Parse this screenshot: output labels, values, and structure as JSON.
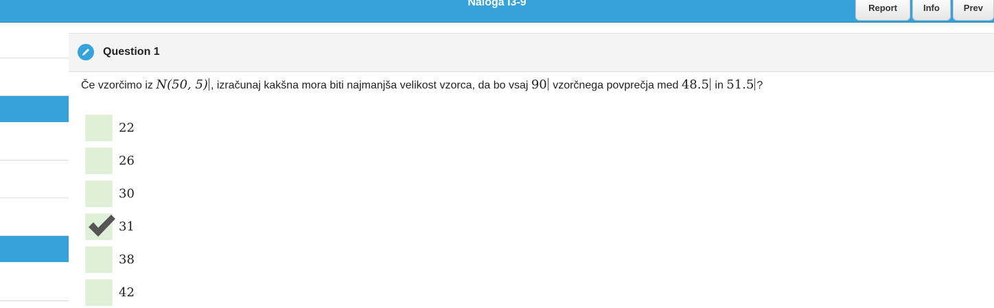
{
  "header": {
    "title": "Naloga I3-9",
    "buttons": {
      "report": "Report",
      "info": "Info",
      "prev": "Prev"
    }
  },
  "question": {
    "title": "Question 1",
    "icon": "pencil-icon",
    "text": {
      "part1": "Če vzorčimo iz ",
      "math1": "N(50, 5)",
      "part2": ", izračunaj kakšna mora biti najmanjša velikost vzorca, da bo vsaj ",
      "math2": "90",
      "part3": " vzorčnega povprečja med ",
      "math3": "48.5",
      "part4": " in ",
      "math4": "51.5",
      "part5": "?"
    }
  },
  "answers": [
    {
      "label": "22",
      "checked": false
    },
    {
      "label": "26",
      "checked": false
    },
    {
      "label": "30",
      "checked": false
    },
    {
      "label": "31",
      "checked": true
    },
    {
      "label": "38",
      "checked": false
    },
    {
      "label": "42",
      "checked": false
    }
  ],
  "colors": {
    "accent": "#35a2d9",
    "answer_box": "#dff0d8",
    "check": "#555555"
  }
}
